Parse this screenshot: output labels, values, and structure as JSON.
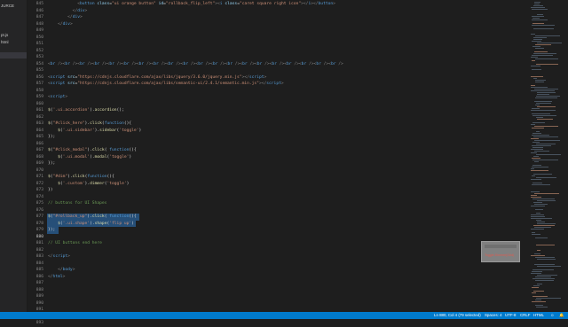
{
  "sidebar": {
    "items": [
      {
        "label": "JURCE",
        "selected": false
      },
      {
        "label": "pt.js",
        "selected": false
      },
      {
        "label": "html",
        "selected": false
      },
      {
        "label": "",
        "selected": true
      }
    ]
  },
  "editor": {
    "current_line": "880",
    "lines": [
      {
        "n": "845",
        "html": "            <span class='t'>&lt;</span><span class='k'>button</span> <span class='a'>class</span>=<span class='s'>\"ui orange button\"</span> <span class='a'>id</span>=<span class='s'>\"rollback_flip_left\"</span><span class='t'>&gt;&lt;</span><span class='k'>i</span> <span class='a'>class</span>=<span class='s'>\"caret square right icon\"</span><span class='t'>&gt;&lt;/</span><span class='k'>i</span><span class='t'>&gt;&lt;/</span><span class='k'>button</span><span class='t'>&gt;</span>"
      },
      {
        "n": "846",
        "html": "          <span class='t'>&lt;/</span><span class='k'>div</span><span class='t'>&gt;</span>"
      },
      {
        "n": "847",
        "html": "        <span class='t'>&lt;/</span><span class='k'>div</span><span class='t'>&gt;</span>"
      },
      {
        "n": "848",
        "html": "    <span class='t'>&lt;/</span><span class='k'>div</span><span class='t'>&gt;</span>"
      },
      {
        "n": "849",
        "html": ""
      },
      {
        "n": "850",
        "html": ""
      },
      {
        "n": "851",
        "html": ""
      },
      {
        "n": "852",
        "html": ""
      },
      {
        "n": "853",
        "html": ""
      },
      {
        "n": "854",
        "html": "<span class='t'>&lt;</span><span class='k'>br</span> <span class='t'>/&gt;&lt;</span><span class='k'>br</span> <span class='t'>/&gt;&lt;</span><span class='k'>br</span> <span class='t'>/&gt;&lt;</span><span class='k'>br</span> <span class='t'>/&gt;&lt;</span><span class='k'>br</span> <span class='t'>/&gt;&lt;</span><span class='k'>br</span> <span class='t'>/&gt;&lt;</span><span class='k'>br</span> <span class='t'>/&gt;&lt;</span><span class='k'>br</span> <span class='t'>/&gt;&lt;</span><span class='k'>br</span> <span class='t'>/&gt;&lt;</span><span class='k'>br</span> <span class='t'>/&gt;&lt;</span><span class='k'>br</span> <span class='t'>/&gt;&lt;</span><span class='k'>br</span> <span class='t'>/&gt;&lt;</span><span class='k'>br</span> <span class='t'>/&gt;&lt;</span><span class='k'>br</span> <span class='t'>/&gt;&lt;</span><span class='k'>br</span> <span class='t'>/&gt;&lt;</span><span class='k'>br</span> <span class='t'>/&gt;&lt;</span><span class='k'>br</span> <span class='t'>/&gt;&lt;</span><span class='k'>br</span> <span class='t'>/&gt;&lt;</span><span class='k'>br</span> <span class='t'>/&gt;&lt;</span><span class='k'>br</span> <span class='t'>/&gt;</span>"
      },
      {
        "n": "855",
        "html": ""
      },
      {
        "n": "856",
        "html": "<span class='t'>&lt;</span><span class='k'>script</span> <span class='a'>src</span>=<span class='s'>\"https://cdnjs.cloudflare.com/ajax/libs/jquery/3.6.0/jquery.min.js\"</span><span class='t'>&gt;&lt;/</span><span class='k'>script</span><span class='t'>&gt;</span>"
      },
      {
        "n": "857",
        "html": "<span class='t'>&lt;</span><span class='k'>script</span> <span class='a'>src</span>=<span class='s'>\"https://cdnjs.cloudflare.com/ajax/libs/semantic-ui/2.4.1/semantic.min.js\"</span><span class='t'>&gt;&lt;/</span><span class='k'>script</span><span class='t'>&gt;</span>"
      },
      {
        "n": "858",
        "html": ""
      },
      {
        "n": "859",
        "html": "<span class='t'>&lt;</span><span class='k'>script</span><span class='t'>&gt;</span>"
      },
      {
        "n": "860",
        "html": ""
      },
      {
        "n": "861",
        "html": "<span class='f'>$</span>(<span class='s'>'.ui.accordion'</span>).<span class='f'>accordion</span>();"
      },
      {
        "n": "862",
        "html": ""
      },
      {
        "n": "863",
        "html": "<span class='f'>$</span>(<span class='s'>\"#click_here\"</span>).<span class='f'>click</span>(<span class='k'>function</span>(){"
      },
      {
        "n": "864",
        "html": "    <span class='f'>$</span>(<span class='s'>'.ui.sidebar'</span>).<span class='f'>sidebar</span>(<span class='s'>'toggle'</span>)"
      },
      {
        "n": "865",
        "html": "});"
      },
      {
        "n": "866",
        "html": ""
      },
      {
        "n": "867",
        "html": "<span class='f'>$</span>(<span class='s'>\"#click_modal\"</span>).<span class='f'>click</span>( <span class='k'>function</span>(){"
      },
      {
        "n": "868",
        "html": "    <span class='f'>$</span>(<span class='s'>'.ui.modal'</span>).<span class='f'>modal</span>(<span class='s'>'toggle'</span>)"
      },
      {
        "n": "869",
        "html": "});"
      },
      {
        "n": "870",
        "html": ""
      },
      {
        "n": "871",
        "html": "<span class='f'>$</span>(<span class='s'>\"#dim\"</span>).<span class='f'>click</span>(<span class='k'>function</span>(){"
      },
      {
        "n": "872",
        "html": "    <span class='f'>$</span>(<span class='s'>'.custom'</span>).<span class='f'>dimmer</span>(<span class='s'>'toggle'</span>)"
      },
      {
        "n": "873",
        "html": "})"
      },
      {
        "n": "874",
        "html": ""
      },
      {
        "n": "875",
        "html": "<span class='c'>// buttons for UI Shapes</span>"
      },
      {
        "n": "876",
        "html": ""
      },
      {
        "n": "877",
        "html": "<span class='f'>$</span>(<span class='s'>\"#rollback_up\"</span>).<span class='f'>click</span>( <span class='k'>function</span>(){"
      },
      {
        "n": "878",
        "html": "    <span class='f'>$</span>(<span class='s'>'.ui.shape'</span>).<span class='f'>shape</span>(<span class='s'>'flip up'</span>)"
      },
      {
        "n": "879",
        "html": "});"
      },
      {
        "n": "880",
        "html": ""
      },
      {
        "n": "881",
        "html": "<span class='c'>// UI buttons end here</span>"
      },
      {
        "n": "882",
        "html": ""
      },
      {
        "n": "883",
        "html": "<span class='t'>&lt;/</span><span class='k'>script</span><span class='t'>&gt;</span>"
      },
      {
        "n": "884",
        "html": ""
      },
      {
        "n": "885",
        "html": "    <span class='t'>&lt;/</span><span class='k'>body</span><span class='t'>&gt;</span>"
      },
      {
        "n": "886",
        "html": "<span class='t'>&lt;/</span><span class='k'>html</span><span class='t'>&gt;</span>"
      },
      {
        "n": "887",
        "html": ""
      },
      {
        "n": "888",
        "html": ""
      },
      {
        "n": "889",
        "html": ""
      },
      {
        "n": "890",
        "html": ""
      },
      {
        "n": "891",
        "html": ""
      },
      {
        "n": "892",
        "html": ""
      },
      {
        "n": "893",
        "html": ""
      }
    ]
  },
  "preview": {
    "button_label": "Toggle Dimmer(Grid)"
  },
  "statusbar": {
    "position": "Ln 880, Col 4 (79 selected)",
    "spaces": "Spaces: 4",
    "encoding": "UTF-8",
    "eol": "CRLF",
    "language": "HTML"
  },
  "colors": {
    "statusbar": "#007acc",
    "editor_bg": "#1e1e1e",
    "selection": "#264f78"
  }
}
